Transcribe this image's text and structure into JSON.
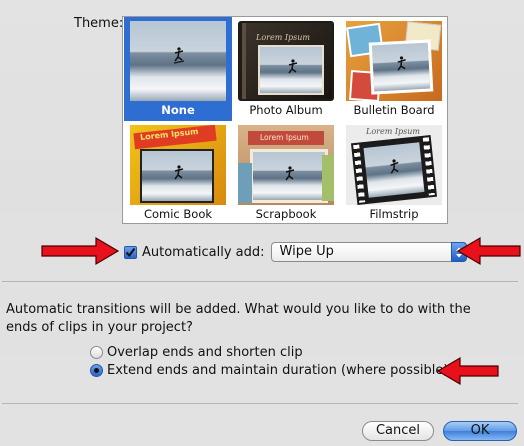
{
  "theme": {
    "label": "Theme:",
    "tiles": [
      {
        "name": "None",
        "selected": true
      },
      {
        "name": "Photo Album"
      },
      {
        "name": "Bulletin Board"
      },
      {
        "name": "Comic Book"
      },
      {
        "name": "Scrapbook"
      },
      {
        "name": "Filmstrip"
      }
    ],
    "overlay_text": "Lorem Ipsum"
  },
  "auto_add": {
    "label": "Automatically add:",
    "checked": true,
    "selected_value": "Wipe Up"
  },
  "transitions": {
    "description": "Automatic transitions will be added. What would you like to do with the ends of clips in your project?",
    "options": [
      {
        "label": "Overlap ends and shorten clip",
        "selected": false
      },
      {
        "label": "Extend ends and maintain duration (where possible)",
        "selected": true
      }
    ]
  },
  "buttons": {
    "cancel": "Cancel",
    "ok": "OK"
  },
  "colors": {
    "selection": "#2e6ed2",
    "annotation_arrow": "#e8101a",
    "default_button": "#3d7fdc"
  }
}
